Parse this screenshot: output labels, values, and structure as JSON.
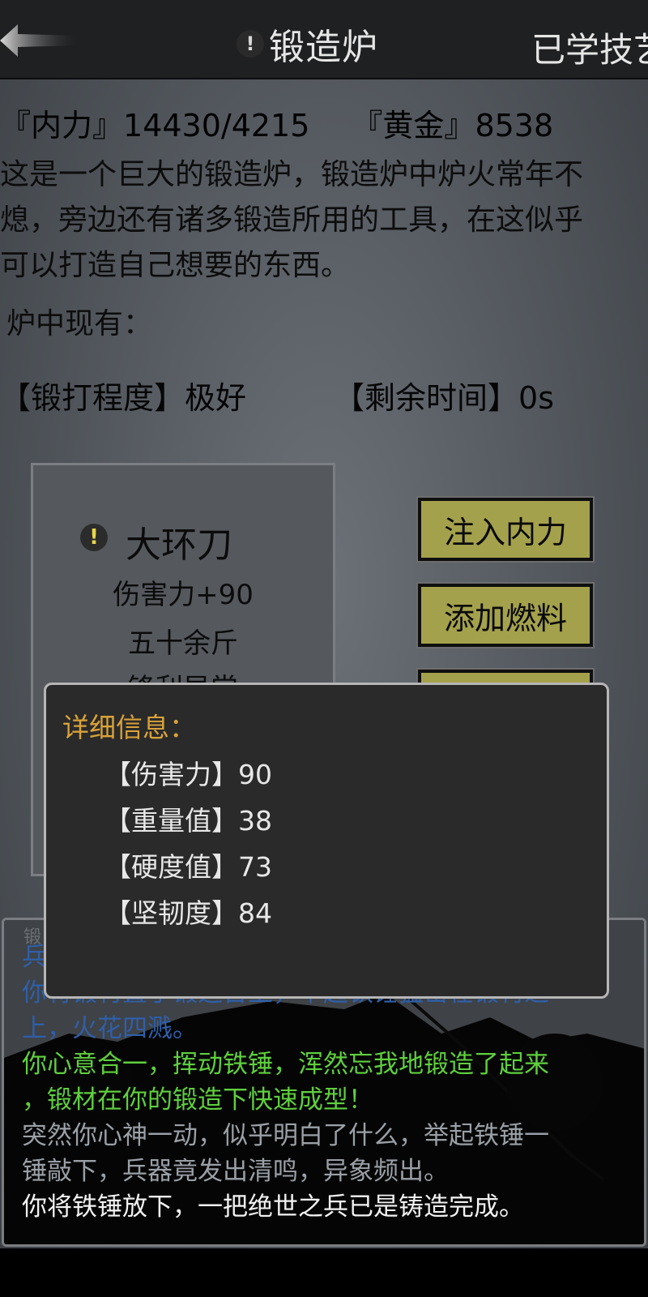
{
  "header": {
    "title": "锻造炉",
    "title_alert": "!",
    "learned_skills_tab": "已学技艺"
  },
  "stats": {
    "neili_label": "『内力』",
    "neili_value": "14430/4215",
    "gold_label": "『黄金』",
    "gold_value": "8538"
  },
  "description": {
    "lines": [
      "这是一个巨大的锻造炉，锻造炉中炉火常年不",
      "熄，旁边还有诸多锻造所用的工具，在这似乎",
      "可以打造自己想要的东西。"
    ],
    "furnace_label": "炉中现有："
  },
  "progress": {
    "forge_label": "【锻打程度】",
    "forge_value": "极好",
    "time_label": "【剩余时间】",
    "time_value": "0s"
  },
  "item": {
    "alert": "!",
    "name": "大环刀",
    "lines": [
      "伤害力+90",
      "五十余斤",
      "锋利异常"
    ]
  },
  "actions": {
    "inject_label": "注入内力",
    "fuel_label": "添加燃料"
  },
  "detail": {
    "title": "详细信息：",
    "rows": [
      {
        "label": "【伤害力】",
        "value": "90"
      },
      {
        "label": "【重量值】",
        "value": "38"
      },
      {
        "label": "【硬度值】",
        "value": "73"
      },
      {
        "label": "【坚韧度】",
        "value": "84"
      }
    ]
  },
  "log": {
    "header_fragment": "锻",
    "lines": [
      {
        "text": "兵",
        "color": "blue"
      },
      {
        "text": "你将锻材置于锻造台上，举起铁锤猛击在锻材之",
        "color": "blue"
      },
      {
        "text": "上，火花四溅。",
        "color": "blue"
      },
      {
        "text": "你心意合一，挥动铁锤，浑然忘我地锻造了起来",
        "color": "green"
      },
      {
        "text": "，锻材在你的锻造下快速成型！",
        "color": "green"
      },
      {
        "text": "突然你心神一动，似乎明白了什么，举起铁锤一",
        "color": "gray"
      },
      {
        "text": "锤敲下，兵器竟发出清鸣，异象频出。",
        "color": "gray"
      },
      {
        "text": "你将铁锤放下，一把绝世之兵已是铸造完成。",
        "color": "white"
      }
    ]
  }
}
